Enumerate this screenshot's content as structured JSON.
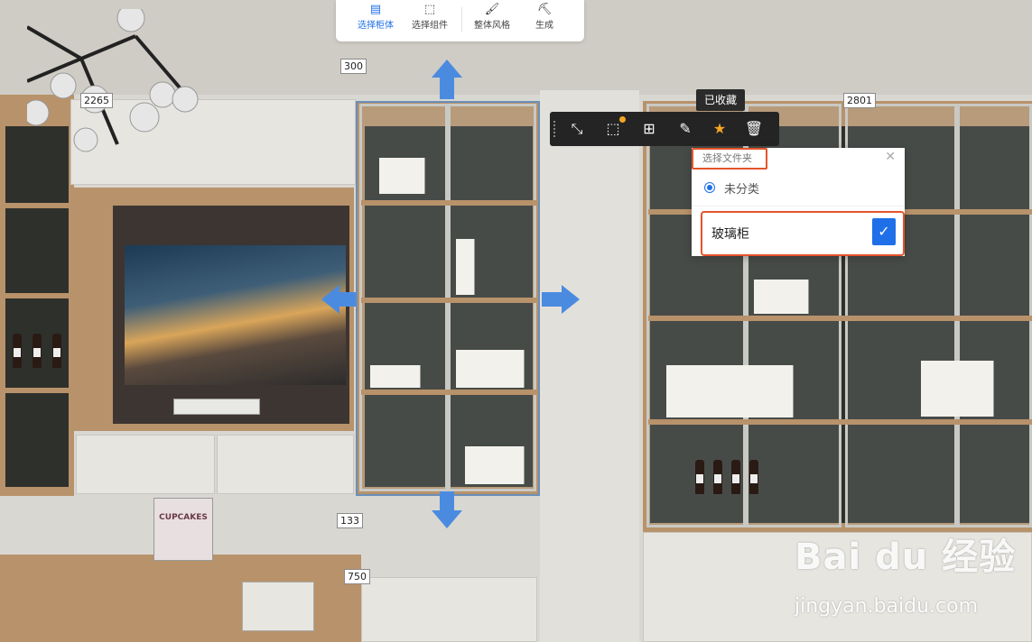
{
  "toolbar": {
    "tabs": [
      {
        "label": "选择柜体",
        "icon": "cabinet-select-icon"
      },
      {
        "label": "选择组件",
        "icon": "component-select-icon"
      },
      {
        "label": "整体风格",
        "icon": "paint-roller-icon"
      },
      {
        "label": "生成",
        "icon": "generate-icon"
      }
    ],
    "active_tab": 0
  },
  "float_toolbar": {
    "buttons": [
      "resize-icon",
      "component-dots-icon",
      "add-copy-icon",
      "brush-icon",
      "star-icon",
      "trash-icon"
    ],
    "tooltip": "已收藏"
  },
  "dimensions": [
    "300",
    "2265",
    "2801",
    "133",
    "750"
  ],
  "favorites_dialog": {
    "title": "选择文件夹",
    "option": "未分类",
    "input_value": "玻璃柜",
    "confirm_icon": "check-icon"
  },
  "scene": {
    "book_title": "CUPCAKES"
  },
  "watermark": {
    "brand": "Bai du 经验",
    "url": "jingyan.baidu.com"
  },
  "colors": {
    "accent": "#1f6fe8",
    "highlight": "#e5542a",
    "arrow": "#4a8be0"
  }
}
